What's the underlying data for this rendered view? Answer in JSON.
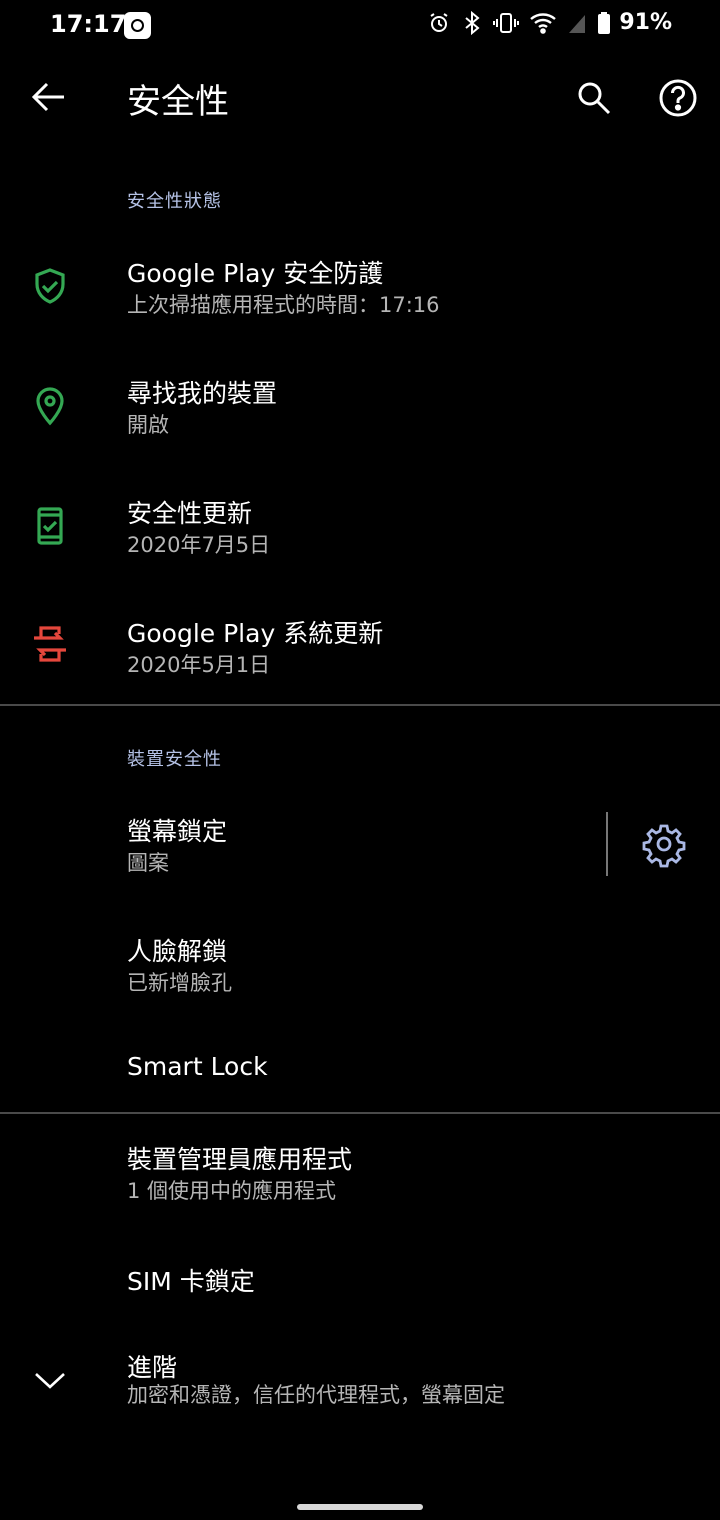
{
  "status_bar": {
    "time": "17:17",
    "battery_percent": "91%",
    "icons": [
      "alarm-icon",
      "bluetooth-icon",
      "vibrate-icon",
      "wifi-icon",
      "cell-signal-icon",
      "battery-icon"
    ]
  },
  "app_bar": {
    "title": "安全性",
    "icons": [
      "back-arrow-icon",
      "search-icon",
      "help-icon"
    ]
  },
  "sections": [
    {
      "header": "安全性狀態",
      "items": [
        {
          "title": "Google Play 安全防護",
          "subtitle": "上次掃描應用程式的時間：17:16",
          "icon": "shield-check-icon",
          "icon_color": "#34a853"
        },
        {
          "title": "尋找我的裝置",
          "subtitle": "開啟",
          "icon": "location-pin-icon",
          "icon_color": "#34a853"
        },
        {
          "title": "安全性更新",
          "subtitle": "2020年7月5日",
          "icon": "phone-check-icon",
          "icon_color": "#34a853"
        },
        {
          "title": "Google Play 系統更新",
          "subtitle": "2020年5月1日",
          "icon": "system-update-icon",
          "icon_color": "#e5473c"
        }
      ]
    },
    {
      "header": "裝置安全性",
      "items": [
        {
          "title": "螢幕鎖定",
          "subtitle": "圖案",
          "icon": "gear-icon"
        },
        {
          "title": "人臉解鎖",
          "subtitle": "已新增臉孔"
        },
        {
          "title": "Smart Lock"
        }
      ]
    },
    {
      "items": [
        {
          "title": "裝置管理員應用程式",
          "subtitle": "1 個使用中的應用程式"
        },
        {
          "title": "SIM 卡鎖定"
        },
        {
          "title": "進階",
          "subtitle": "加密和憑證，信任的代理程式，螢幕固定",
          "icon": "chevron-down-icon"
        }
      ]
    }
  ],
  "colors": {
    "background": "#000000",
    "section_header": "#b5c2e6",
    "secure_green": "#34a853",
    "warning_red": "#e5473c",
    "gear_blue": "#aab8e4"
  }
}
